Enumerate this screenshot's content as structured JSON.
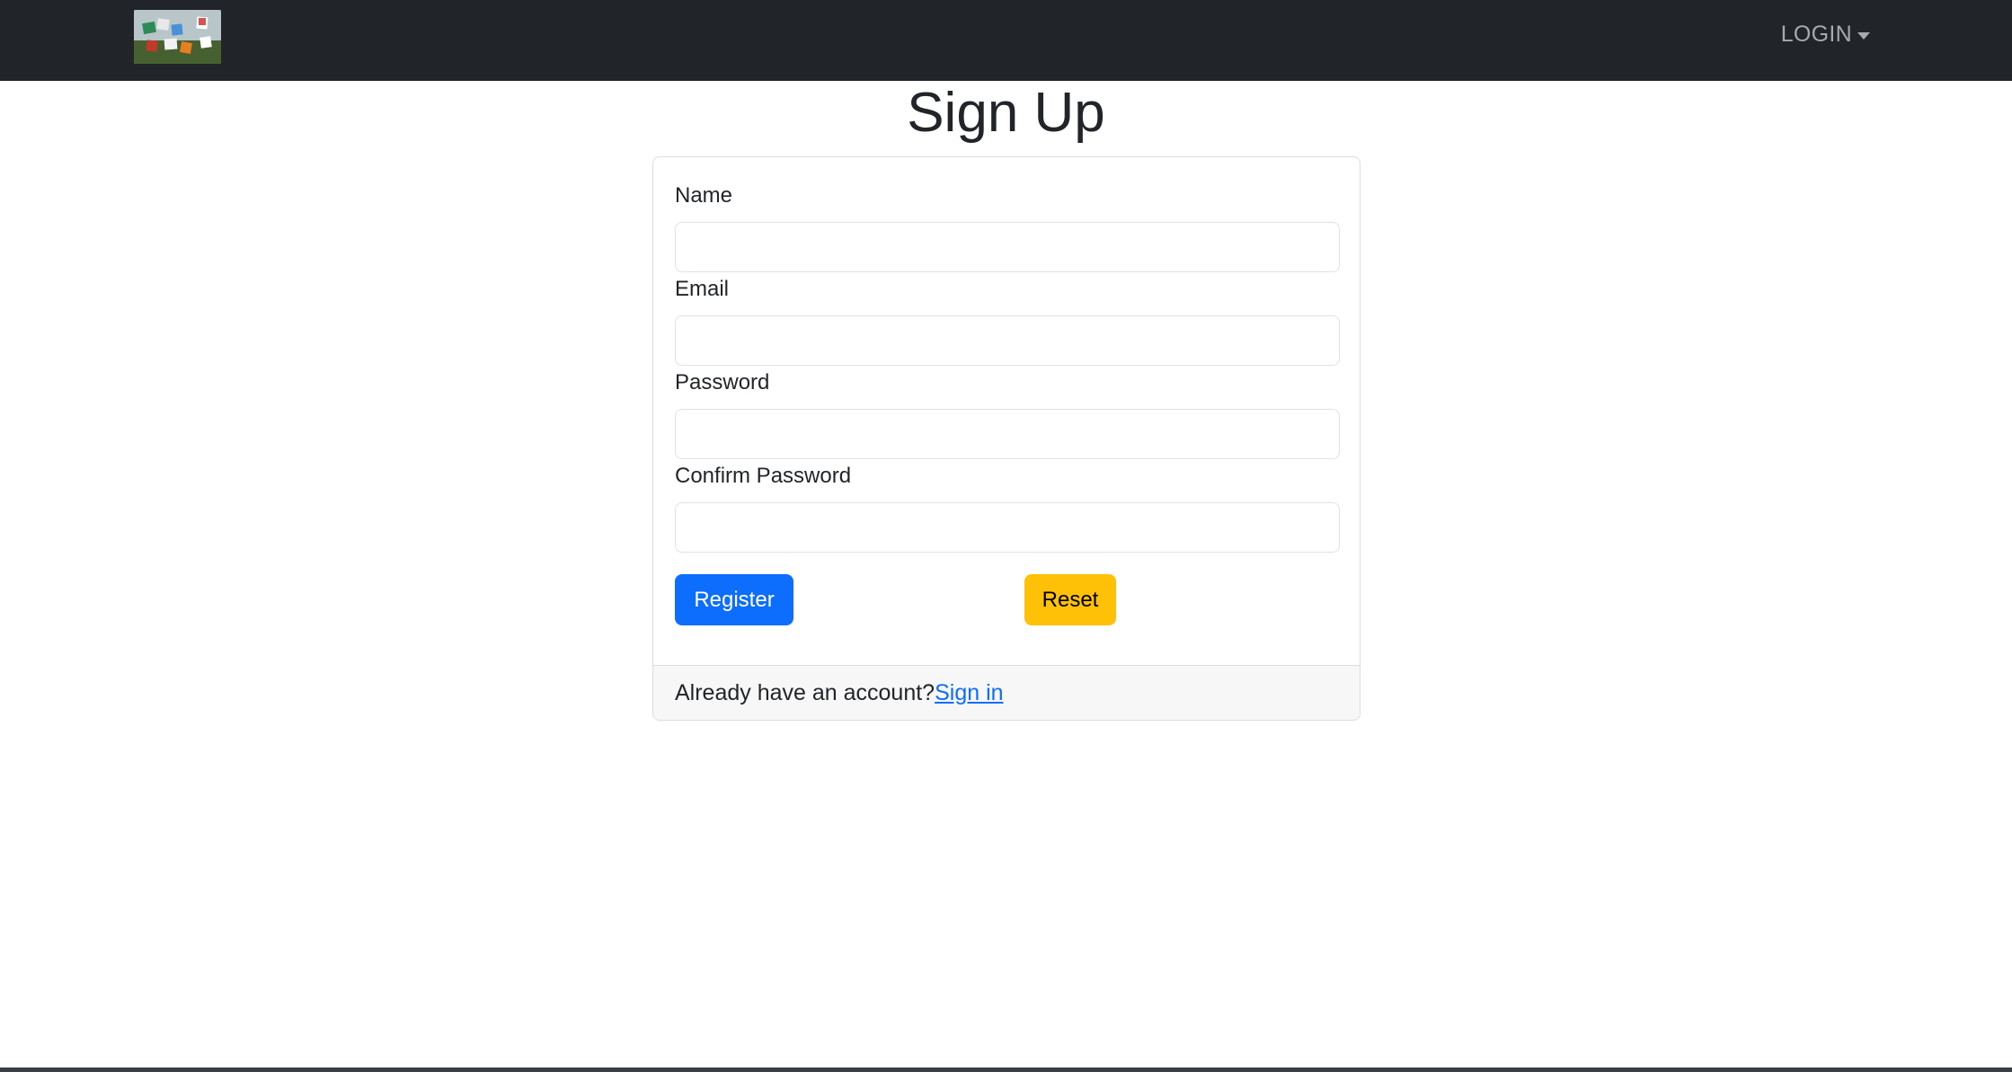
{
  "navbar": {
    "logo_alt": "site logo",
    "login_label": "LOGIN"
  },
  "page": {
    "title": "Sign Up"
  },
  "form": {
    "name_label": "Name",
    "email_label": "Email",
    "password_label": "Password",
    "confirm_password_label": "Confirm Password",
    "name_value": "",
    "email_value": "",
    "password_value": "",
    "confirm_password_value": "",
    "register_label": "Register",
    "reset_label": "Reset"
  },
  "footer": {
    "prompt_text": "Already have an account?",
    "signin_label": "Sign in"
  },
  "colors": {
    "navbar_bg": "#212529",
    "primary": "#0d6efd",
    "warning": "#ffc107"
  }
}
